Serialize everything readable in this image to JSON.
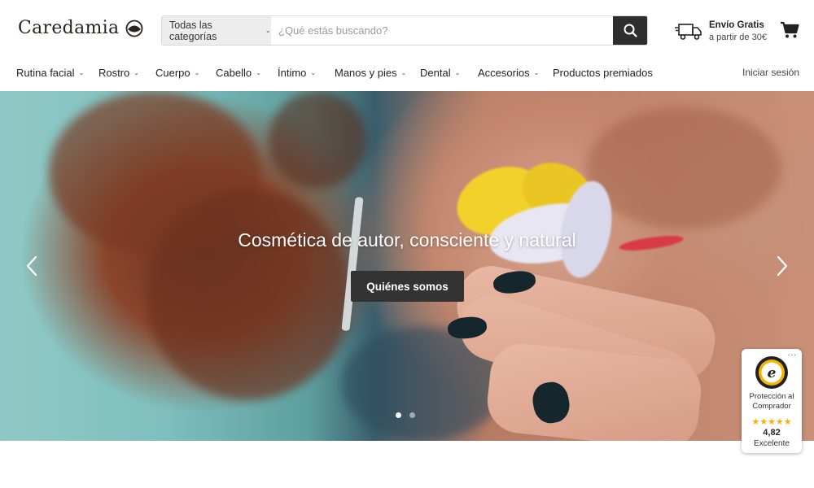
{
  "brand": {
    "name": "Caredamia"
  },
  "search": {
    "category_label": "Todas las categorías",
    "placeholder": "¿Qué estás buscando?",
    "value": ""
  },
  "shipping": {
    "title": "Envío Gratis",
    "subtitle": "a partir de 30€"
  },
  "nav": {
    "items": [
      {
        "label": "Rutina facial",
        "has_dropdown": true
      },
      {
        "label": "Rostro",
        "has_dropdown": true
      },
      {
        "label": "Cuerpo",
        "has_dropdown": true
      },
      {
        "label": "Cabello",
        "has_dropdown": true
      },
      {
        "label": "Íntimo",
        "has_dropdown": true
      },
      {
        "label": "Manos y pies",
        "has_dropdown": true
      },
      {
        "label": "Dental",
        "has_dropdown": true
      },
      {
        "label": "Accesorios",
        "has_dropdown": true
      },
      {
        "label": "Productos premiados",
        "has_dropdown": false
      }
    ],
    "login_label": "Iniciar sesión"
  },
  "hero": {
    "title": "Cosmética de autor, consciente y natural",
    "button_label": "Quiénes somos",
    "slides_total": 2,
    "active_slide": 1
  },
  "trust_badge": {
    "more": "...",
    "label": "Protección al Comprador",
    "stars": "★★★★★",
    "score": "4,82",
    "rating_text": "Excelente"
  },
  "icons": {
    "search": "search-icon",
    "shipping": "truck-icon",
    "cart": "cart-icon",
    "prev": "chevron-left-icon",
    "next": "chevron-right-icon",
    "seal": "trusted-shops-seal-icon"
  },
  "colors": {
    "dark_button": "#333333",
    "search_button": "#2e2e2e",
    "star": "#f5b400"
  }
}
